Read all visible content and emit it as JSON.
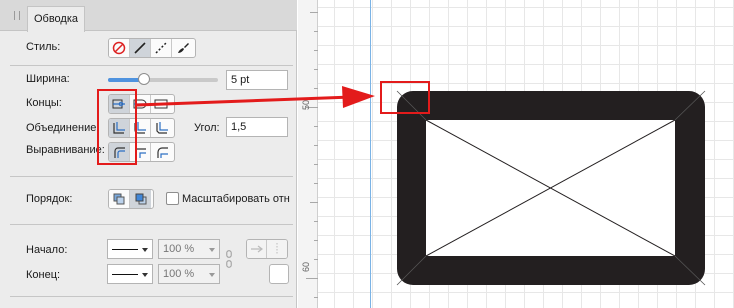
{
  "panel": {
    "tab_label": "Обводка",
    "style": {
      "label": "Стиль:",
      "buttons": [
        {
          "icon": "no-stroke-icon",
          "selected": false
        },
        {
          "icon": "solid-line-icon",
          "selected": true
        },
        {
          "icon": "dashed-line-icon",
          "selected": false
        },
        {
          "icon": "brush-icon",
          "selected": false
        }
      ]
    },
    "width": {
      "label": "Ширина:",
      "value": "5 pt",
      "slider_fraction": 0.33
    },
    "caps": {
      "label": "Концы:",
      "buttons": [
        "butt-cap-icon",
        "round-cap-icon",
        "square-cap-icon"
      ],
      "selected_index": 0
    },
    "join": {
      "label": "Объединение:",
      "buttons": [
        "miter-join-icon",
        "round-join-icon",
        "bevel-join-icon"
      ],
      "selected_index": 0,
      "angle_label": "Угол:",
      "angle_value": "1,5"
    },
    "align": {
      "label": "Выравнивание:",
      "buttons": [
        "align-center-icon",
        "align-inside-icon",
        "align-outside-icon"
      ],
      "selected_index": 0
    },
    "order": {
      "label": "Порядок:",
      "buttons": [
        "stroke-behind-fill-icon",
        "stroke-front-fill-icon"
      ],
      "selected_index": 1,
      "scale_label": "Масштабировать отн",
      "scale_checked": false
    },
    "start": {
      "label": "Начало:",
      "scale_value": "100 %"
    },
    "end": {
      "label": "Конец:",
      "scale_value": "100 %"
    }
  },
  "ruler": {
    "marks": [
      "50",
      "60"
    ]
  },
  "colors": {
    "accent": "#e31b1b",
    "slider": "#4f93df",
    "shape_stroke": "#231f20"
  }
}
